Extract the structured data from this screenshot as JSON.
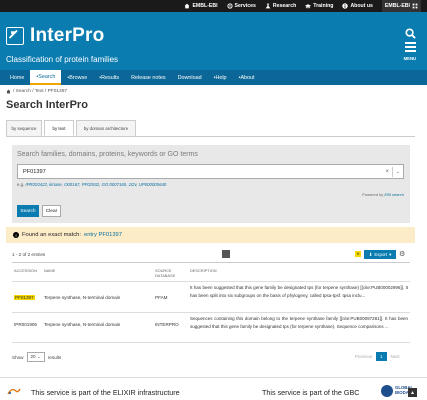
{
  "ebi_bar": {
    "items": [
      {
        "label": "EMBL-EBI",
        "icon": "home-icon"
      },
      {
        "label": "Services",
        "icon": "services-icon"
      },
      {
        "label": "Research",
        "icon": "research-icon"
      },
      {
        "label": "Training",
        "icon": "training-icon"
      },
      {
        "label": "About us",
        "icon": "info-icon"
      }
    ],
    "embl_label": "EMBL-EBI"
  },
  "header": {
    "brand": "InterPro",
    "tagline": "Classification of protein families",
    "menu_label": "MENU"
  },
  "nav": {
    "items": [
      "Home",
      "Search",
      "Browse",
      "Results",
      "Release notes",
      "Download",
      "Help",
      "About"
    ]
  },
  "breadcrumb": "/ Search / Text / PF01397",
  "page_title": "Search InterPro",
  "tabs": [
    "by sequence",
    "by text",
    "by domain architecture"
  ],
  "search": {
    "placeholder": "Search families, domains, proteins, keywords or GO terms",
    "value": "PF01397",
    "examples_prefix": "e.g.",
    "examples": "IPR020422, kinase, O00167, PF02932, GO:0007165, 1t2v, UP000005640",
    "powered_prefix": "Powered by",
    "powered_link": "EBI search",
    "search_button": "Search",
    "clear_button": "Clear"
  },
  "exact_match": {
    "prefix": "Found an exact match:",
    "link": "entry PF01397"
  },
  "results": {
    "count": "1 - 2 of 2 entries",
    "export_label": "Export",
    "columns": [
      "Accession",
      "Name",
      "Source database",
      "Description"
    ],
    "rows": [
      {
        "accession": "PF01397",
        "name": "Terpene synthase, N-terminal domain",
        "source": "PFAM",
        "description": "It has been suggested that this gene family be designated tps (for terpene synthase) [[cite:PUB00002996]]. It has been split into six subgroups on the basis of phylogeny, called tpsa-tpsf. tpsa inclu..."
      },
      {
        "accession": "IPR001906",
        "name": "Terpene synthase, N-terminal domain",
        "source": "INTERPRO",
        "description": "Sequences containing this domain belong to the terpene synthase family [[cite:PUB00097281]]. It has been suggested that this gene family be designated tps (for terpene synthase). Sequence comparisons ..."
      }
    ]
  },
  "table_footer": {
    "show_label": "Show",
    "page_size": "20",
    "results_label": "results",
    "previous": "Previous",
    "page": "1",
    "next": "Next"
  },
  "footer": {
    "elixir_text": "This service is part of the ELIXIR infrastructure",
    "gbc_text": "This service is part of the GBC",
    "gbc_logo_line1": "GLOBAL",
    "gbc_logo_line2": "BIODATA"
  }
}
